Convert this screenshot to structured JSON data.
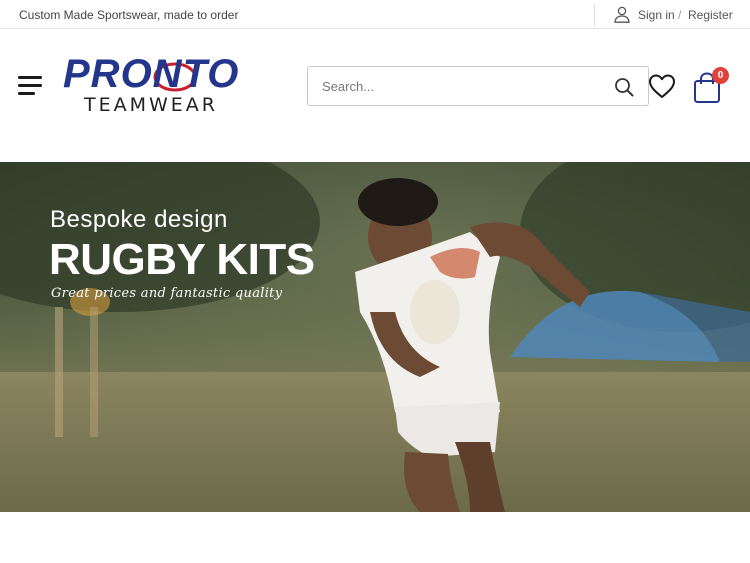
{
  "topbar": {
    "tagline": "Custom Made Sportswear, made to order",
    "signin": "Sign in",
    "separator": "/",
    "register": "Register"
  },
  "header": {
    "logo": {
      "wordmark": "PRONTO",
      "sub": "TEAMWEAR"
    },
    "search": {
      "placeholder": "Search..."
    },
    "cart": {
      "count": "0"
    }
  },
  "hero": {
    "subtitle": "Bespoke design",
    "title": "RUGBY KITS",
    "tagline": "Great prices and fantastic quality"
  },
  "colors": {
    "brand_blue": "#24368c",
    "logo_red": "#c8202f",
    "badge_red": "#e0413a"
  },
  "icons": [
    "user-icon",
    "menu-icon",
    "search-icon",
    "heart-icon",
    "shopping-bag-icon"
  ]
}
